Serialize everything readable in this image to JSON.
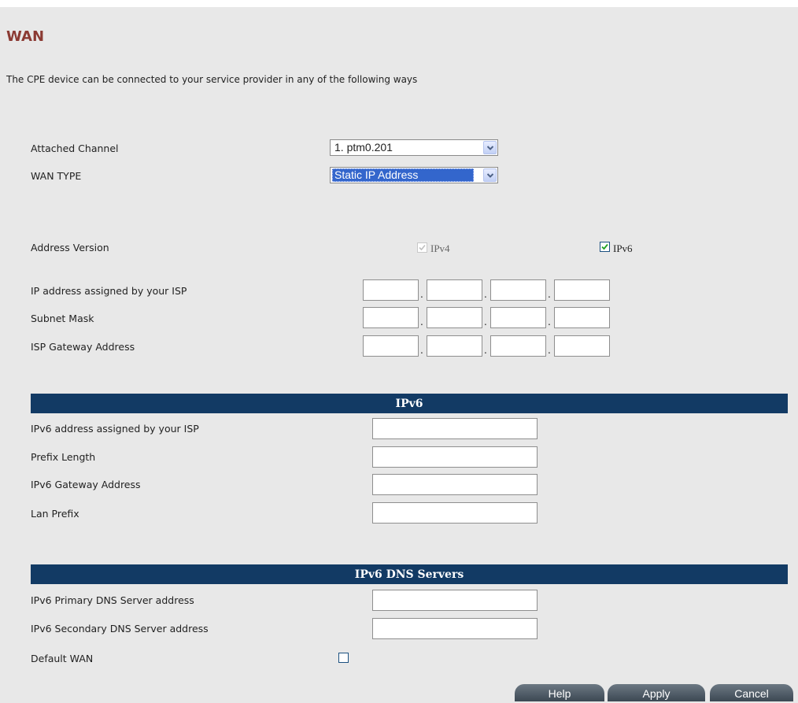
{
  "page": {
    "title": "WAN",
    "intro": "The CPE device can be connected to your service provider in any of the following ways"
  },
  "channel": {
    "label": "Attached Channel",
    "value": "1. ptm0.201"
  },
  "wan_type": {
    "label": "WAN TYPE",
    "value": "Static IP Address"
  },
  "address_version": {
    "label": "Address Version",
    "ipv4": {
      "label": "IPv4",
      "checked": true,
      "disabled": true
    },
    "ipv6": {
      "label": "IPv6",
      "checked": true
    }
  },
  "ipv4_fields": [
    {
      "label": "IP address assigned by your ISP",
      "octets": [
        "",
        "",
        "",
        ""
      ]
    },
    {
      "label": "Subnet Mask",
      "octets": [
        "",
        "",
        "",
        ""
      ]
    },
    {
      "label": "ISP Gateway Address",
      "octets": [
        "",
        "",
        "",
        ""
      ]
    }
  ],
  "ipv6_section": {
    "header": "IPv6",
    "fields": [
      {
        "label": "IPv6 address assigned by your ISP",
        "value": ""
      },
      {
        "label": "Prefix Length",
        "value": ""
      },
      {
        "label": "IPv6 Gateway Address",
        "value": ""
      },
      {
        "label": "Lan Prefix",
        "value": ""
      }
    ]
  },
  "dns_section": {
    "header": "IPv6 DNS Servers",
    "fields": [
      {
        "label": "IPv6 Primary DNS Server address",
        "value": ""
      },
      {
        "label": "IPv6 Secondary DNS Server address",
        "value": ""
      }
    ]
  },
  "default_wan": {
    "label": "Default WAN",
    "checked": false
  },
  "buttons": {
    "help": "Help",
    "apply": "Apply",
    "cancel": "Cancel"
  },
  "colors": {
    "title": "#8b3a33",
    "section_bar": "#123a64",
    "background": "#e8e8e8",
    "button": "#4a5661"
  }
}
